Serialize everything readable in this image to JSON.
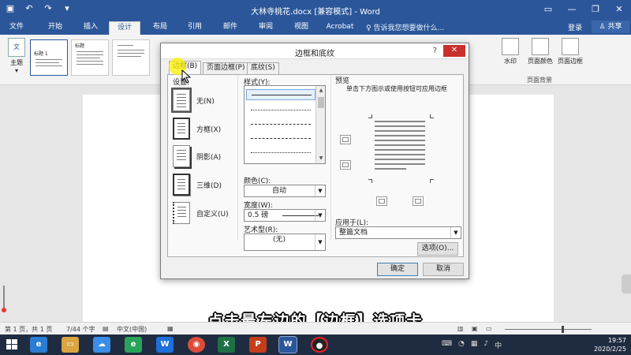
{
  "window": {
    "title": "大林寺桃花.docx [兼容模式] - Word",
    "qat_icons": [
      "save-icon",
      "undo-icon",
      "redo-icon",
      "customize-icon"
    ]
  },
  "ribbon_tabs": [
    {
      "label": "文件"
    },
    {
      "label": "开始"
    },
    {
      "label": "插入"
    },
    {
      "label": "设计",
      "active": true
    },
    {
      "label": "布局"
    },
    {
      "label": "引用"
    },
    {
      "label": "邮件"
    },
    {
      "label": "审阅"
    },
    {
      "label": "视图"
    },
    {
      "label": "Acrobat"
    }
  ],
  "tell_me": "告诉我您想要做什么...",
  "account": {
    "login": "登录",
    "share": "共享"
  },
  "ribbon": {
    "theme_label": "主题",
    "theme_icon_text": "文",
    "gallery": [
      {
        "label": "标题 1"
      },
      {
        "label": "标题"
      },
      {
        "label": ""
      }
    ],
    "page_background": {
      "watermark": "水印",
      "page_color": "页面颜色",
      "page_borders": "页面边框",
      "group_label": "页面背景"
    }
  },
  "dialog": {
    "title": "边框和底纹",
    "help": "?",
    "close": "✕",
    "tabs": [
      {
        "label": "边框(B)",
        "active": true
      },
      {
        "label": "页面边框(P)"
      },
      {
        "label": "底纹(S)"
      }
    ],
    "settings_label": "设置:",
    "settings": [
      {
        "label": "无(N)"
      },
      {
        "label": "方框(X)"
      },
      {
        "label": "阴影(A)"
      },
      {
        "label": "三维(D)"
      },
      {
        "label": "自定义(U)"
      }
    ],
    "style_label": "样式(Y):",
    "color_label": "颜色(C):",
    "color_value": "自动",
    "width_label": "宽度(W):",
    "width_value": "0.5 磅",
    "art_label": "艺术型(R):",
    "art_value": "(无)",
    "preview_label": "预览",
    "preview_hint": "单击下方图示或使用按钮可应用边框",
    "apply_label": "应用于(L):",
    "apply_value": "整篇文档",
    "options_button": "选项(O)...",
    "ok_button": "确定",
    "cancel_button": "取消"
  },
  "status_bar": {
    "page": "第 1 页，共 1 页",
    "words": "7/44 个字",
    "language": "中文(中国)"
  },
  "caption": "点击最左边的【边框】选项卡",
  "taskbar": {
    "time": "19:57",
    "date": "2020/2/25",
    "ime": "中"
  }
}
